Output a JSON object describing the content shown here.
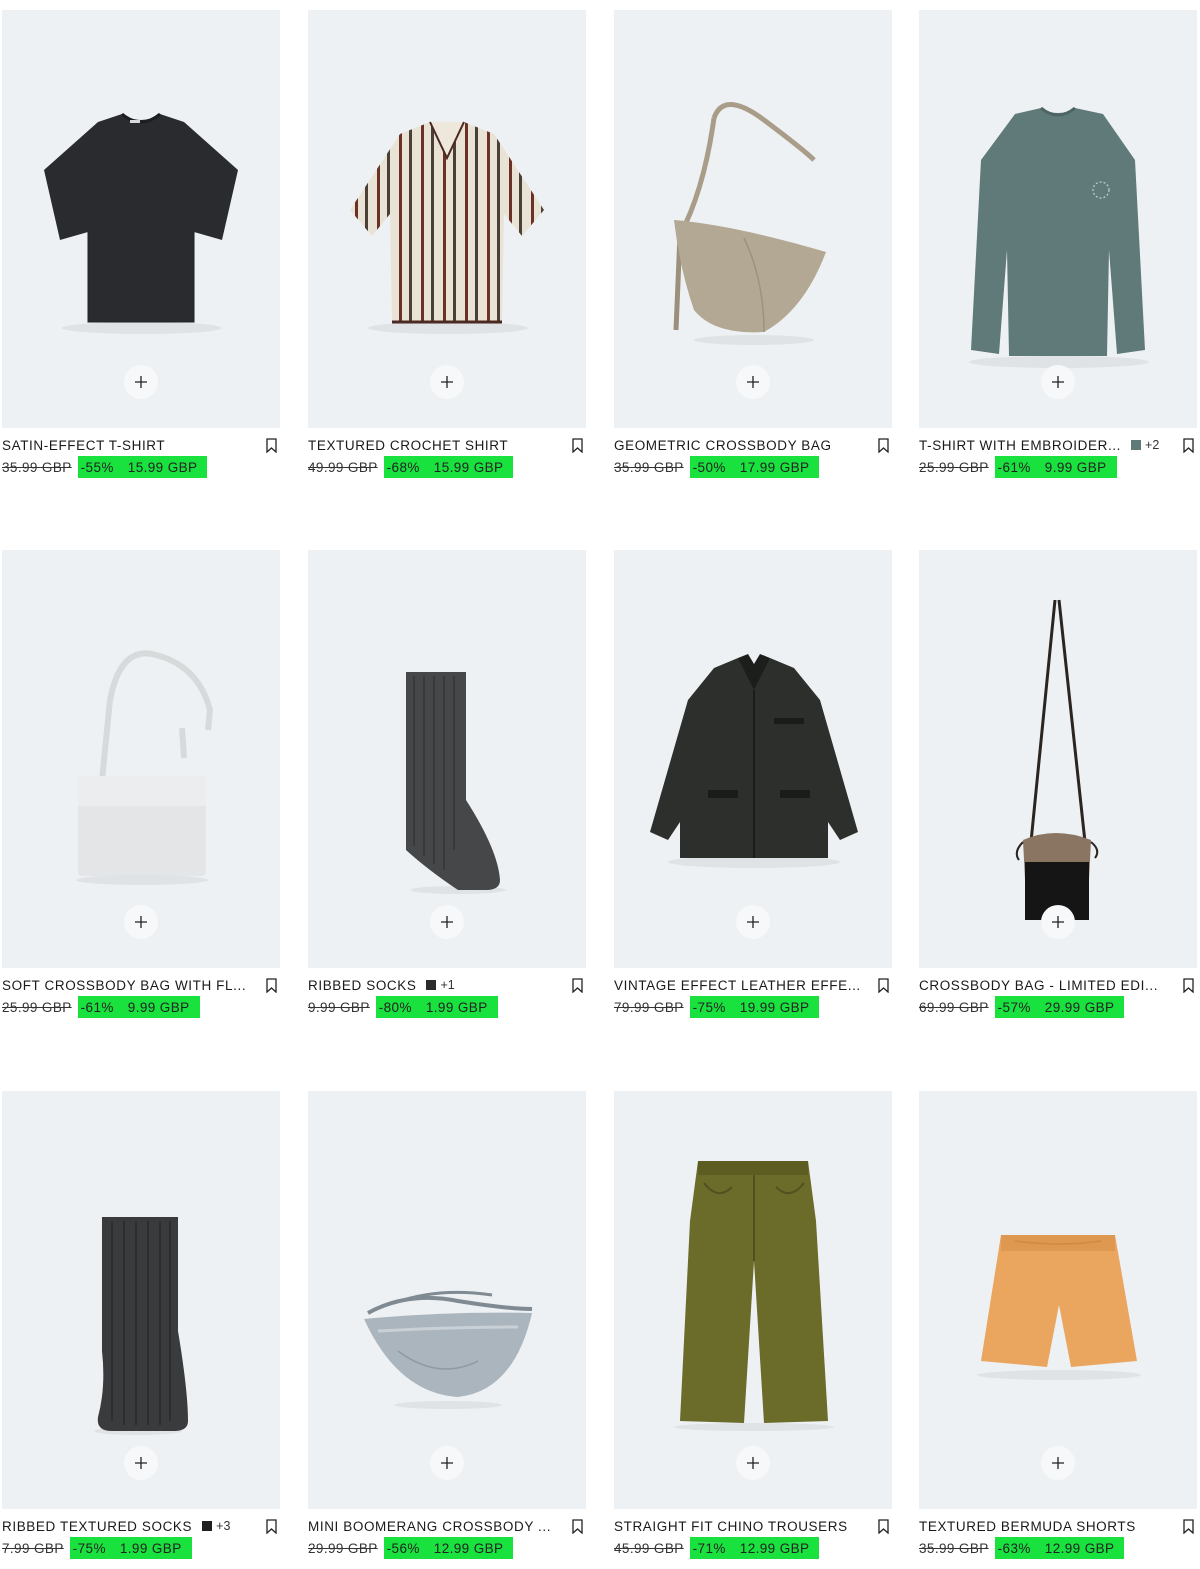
{
  "colors": {
    "sale_highlight": "#19e13e",
    "image_background": "#eef1f3",
    "text": "#1a1a1a"
  },
  "icons": {
    "add": "plus-icon",
    "save": "bookmark-icon"
  },
  "products": [
    {
      "name": "SATIN-EFFECT T-SHIRT",
      "original_price": "35.99 GBP",
      "discount": "-55%",
      "sale_price": "15.99 GBP",
      "swatch": null,
      "image": "black oversized t-shirt"
    },
    {
      "name": "TEXTURED CROCHET SHIRT",
      "original_price": "49.99 GBP",
      "discount": "-68%",
      "sale_price": "15.99 GBP",
      "swatch": null,
      "image": "striped crochet shirt"
    },
    {
      "name": "GEOMETRIC CROSSBODY BAG",
      "original_price": "35.99 GBP",
      "discount": "-50%",
      "sale_price": "17.99 GBP",
      "swatch": null,
      "image": "taupe crossbody bag"
    },
    {
      "name": "T-SHIRT WITH EMBROIDER...",
      "original_price": "25.99 GBP",
      "discount": "-61%",
      "sale_price": "9.99 GBP",
      "swatch": {
        "color": "#5f7a78",
        "count": "+2"
      },
      "image": "green long sleeve t-shirt"
    },
    {
      "name": "SOFT CROSSBODY BAG WITH FL...",
      "original_price": "25.99 GBP",
      "discount": "-61%",
      "sale_price": "9.99 GBP",
      "swatch": null,
      "image": "light grey crossbody bag"
    },
    {
      "name": "RIBBED SOCKS",
      "original_price": "9.99 GBP",
      "discount": "-80%",
      "sale_price": "1.99 GBP",
      "swatch": {
        "color": "#2b2b2b",
        "count": "+1"
      },
      "image": "charcoal ribbed sock"
    },
    {
      "name": "VINTAGE EFFECT LEATHER EFFE...",
      "original_price": "79.99 GBP",
      "discount": "-75%",
      "sale_price": "19.99 GBP",
      "swatch": null,
      "image": "black leather effect jacket"
    },
    {
      "name": "CROSSBODY BAG - LIMITED EDI...",
      "original_price": "69.99 GBP",
      "discount": "-57%",
      "sale_price": "29.99 GBP",
      "swatch": null,
      "image": "black drawstring crossbody bag"
    },
    {
      "name": "RIBBED TEXTURED SOCKS",
      "original_price": "7.99 GBP",
      "discount": "-75%",
      "sale_price": "1.99 GBP",
      "swatch": {
        "color": "#1f1f1f",
        "count": "+3"
      },
      "image": "dark grey textured sock"
    },
    {
      "name": "MINI BOOMERANG CROSSBODY ...",
      "original_price": "29.99 GBP",
      "discount": "-56%",
      "sale_price": "12.99 GBP",
      "swatch": null,
      "image": "metallic mini boomerang bag"
    },
    {
      "name": "STRAIGHT FIT CHINO TROUSERS",
      "original_price": "45.99 GBP",
      "discount": "-71%",
      "sale_price": "12.99 GBP",
      "swatch": null,
      "image": "olive chino trousers"
    },
    {
      "name": "TEXTURED BERMUDA SHORTS",
      "original_price": "35.99 GBP",
      "discount": "-63%",
      "sale_price": "12.99 GBP",
      "swatch": null,
      "image": "orange bermuda shorts"
    }
  ]
}
